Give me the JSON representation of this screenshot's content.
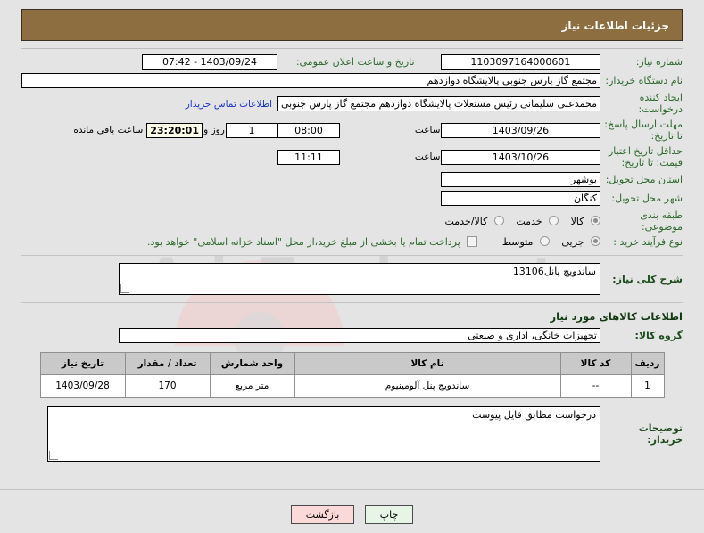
{
  "header": {
    "title": "جزئیات اطلاعات نیاز"
  },
  "form": {
    "need_number_label": "شماره نیاز:",
    "need_number_value": "1103097164000601",
    "announce_label": "تاریخ و ساعت اعلان عمومی:",
    "announce_value": "1403/09/24 - 07:42",
    "buyer_org_label": "نام دستگاه خریدار:",
    "buyer_org_value": "مجتمع گاز پارس جنوبی  پالایشگاه دوازدهم",
    "creator_label": "ایجاد کننده درخواست:",
    "creator_value": "محمدعلی سلیمانی رئیس مستغلات پالایشگاه دوازدهم مجتمع گاز پارس جنوبی",
    "contact_link": "اطلاعات تماس خریدار",
    "deadline_label": "مهلت ارسال پاسخ: تا تاریخ:",
    "deadline_date": "1403/09/26",
    "hour_label": "ساعت",
    "deadline_time": "08:00",
    "days_remaining": "1",
    "days_unit": "روز و",
    "countdown": "23:20:01",
    "countdown_suffix": "ساعت باقی مانده",
    "price_validity_label": "حداقل تاریخ اعتبار قیمت: تا تاریخ:",
    "price_validity_date": "1403/10/26",
    "price_validity_time": "11:11",
    "province_label": "استان محل تحویل:",
    "province_value": "بوشهر",
    "city_label": "شهر محل تحویل:",
    "city_value": "کنگان",
    "category_label": "طبقه بندی موضوعی:",
    "category_options": [
      "کالا",
      "خدمت",
      "کالا/خدمت"
    ],
    "category_selected": "کالا",
    "process_label": "نوع فرآیند خرید :",
    "process_options": [
      "جزیی",
      "متوسط"
    ],
    "process_selected": "جزیی",
    "treasury_checkbox_label": "پرداخت تمام یا بخشی از مبلغ خرید،از محل \"اسناد خزانه اسلامی\" خواهد بود.",
    "treasury_checked": false,
    "summary_label": "شرح کلی نیاز:",
    "summary_value": "ساندویچ پانل13106"
  },
  "goods_section": {
    "heading": "اطلاعات کالاهای مورد نیاز",
    "group_label": "گروه کالا:",
    "group_value": "تجهیزات خانگی، اداری و صنعتی",
    "columns": [
      "ردیف",
      "کد کالا",
      "نام کالا",
      "واحد شمارش",
      "تعداد / مقدار",
      "تاریخ نیاز"
    ],
    "rows": [
      {
        "row_no": "1",
        "code": "--",
        "name": "ساندویچ پنل آلومینیوم",
        "unit": "متر مربع",
        "quantity": "170",
        "need_date": "1403/09/28"
      }
    ]
  },
  "notes": {
    "label": "توضیحات خریدار:",
    "value": "درخواست مطابق فایل پیوست"
  },
  "footer": {
    "print_label": "چاپ",
    "back_label": "بازگشت"
  },
  "watermark": {
    "text": "AriaTender.net"
  },
  "colors": {
    "header_bg": "#8c6e40",
    "page_bg": "#e4e4e4",
    "label_green": "#2c6a2c",
    "link_blue": "#1a34cc",
    "print_btn": "#e6f5e6",
    "back_btn": "#fbd9d9",
    "countdown_bg": "#fbfbe8",
    "grid_header": "#c9c9c9"
  }
}
